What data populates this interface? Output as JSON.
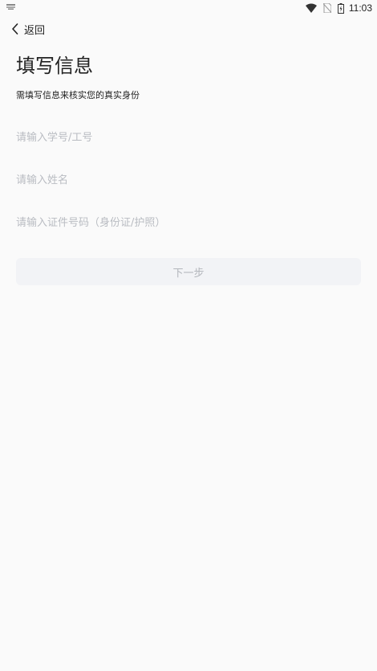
{
  "status_bar": {
    "time": "11:03",
    "icons": [
      "notification-icon",
      "wifi-icon",
      "no-sim-icon",
      "battery-charging-icon"
    ]
  },
  "nav": {
    "back_label": "返回",
    "back_icon": "chevron-left-icon"
  },
  "header": {
    "title": "填写信息",
    "subtitle": "需填写信息来核实您的真实身份"
  },
  "form": {
    "student_id_placeholder": "请输入学号/工号",
    "name_placeholder": "请输入姓名",
    "id_number_placeholder": "请输入证件号码（身份证/护照）",
    "next_label": "下一步"
  },
  "colors": {
    "background": "#fafafa",
    "placeholder": "#b9bcc2",
    "button_bg": "#f2f3f6",
    "button_text": "#b3b6bc"
  }
}
